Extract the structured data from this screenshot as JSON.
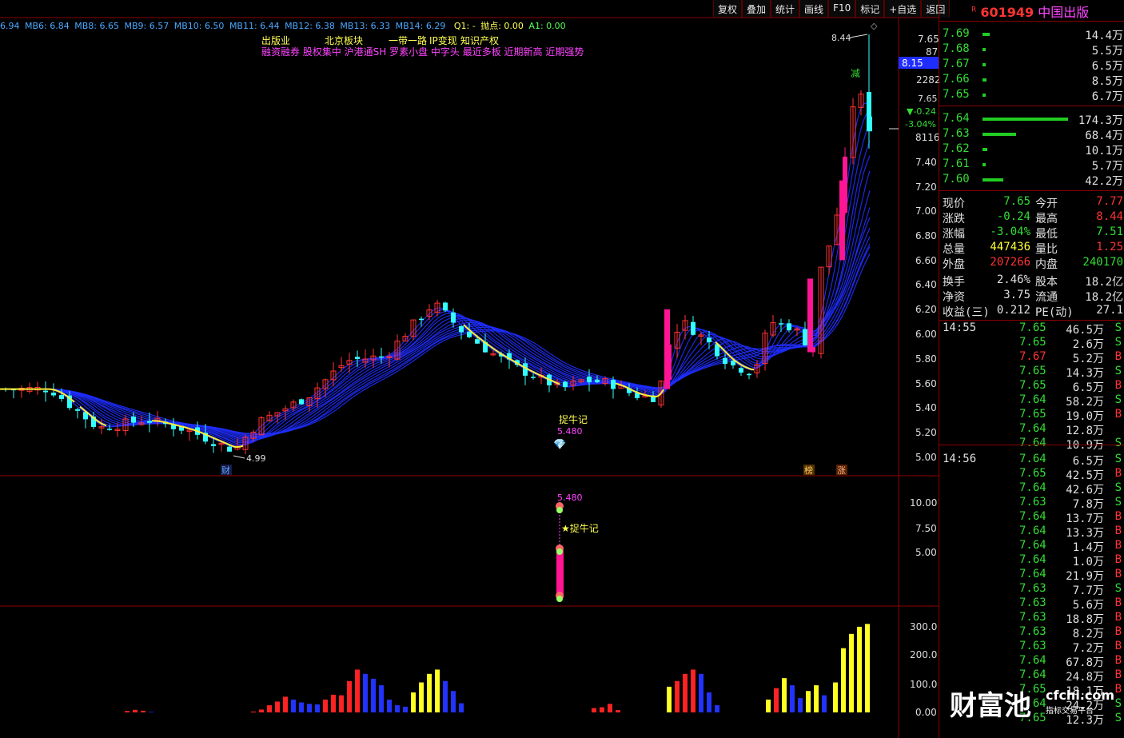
{
  "toolbar": {
    "items": [
      "复权",
      "叠加",
      "统计",
      "画线",
      "F10",
      "标记",
      "+自选",
      "返回"
    ]
  },
  "ma_line": {
    "items": [
      "6.94",
      "MB6: 6.84",
      "MB8: 6.65",
      "MB9: 6.57",
      "MB10: 6.50",
      "MB11: 6.44",
      "MB12: 6.38",
      "MB13: 6.33",
      "MB14: 6.29"
    ],
    "q1": "Q1: -",
    "paodian": "抛点: 0.00",
    "a1": "A1: 0.00"
  },
  "concepts": {
    "row1": [
      "出版业",
      "北京板块",
      "一带一路",
      "IP变现",
      "知识产权"
    ],
    "row2": "融资融券 股权集中 沪港通SH 罗素小盘 中字头 最近多板 近期新高 近期强势"
  },
  "chart_annotations": {
    "high_label": "8.44",
    "low_label": "4.99",
    "bull_label": "捉牛记",
    "bull_price": "5.480",
    "cai": "财",
    "bang": "榜",
    "zhang": "涨",
    "jian": "减",
    "sub_price": "5.480",
    "sub_label": "★捉牛记"
  },
  "price_axis": [
    "7.65",
    "87",
    "8.15",
    "2282",
    "7.65",
    "▼-0.24",
    "-3.04%",
    "8116",
    "7.40",
    "7.20",
    "7.00",
    "6.80",
    "6.60",
    "6.40",
    "6.20",
    "6.00",
    "5.80",
    "5.60",
    "5.40",
    "5.20",
    "5.00"
  ],
  "sub_axis": [
    "10.00",
    "7.50",
    "5.00"
  ],
  "vol_axis": [
    "300.0",
    "200.0",
    "100.0",
    "0.00"
  ],
  "stock": {
    "flag": "R",
    "code": "601949",
    "name": "中国出版"
  },
  "asks": [
    [
      "7.69",
      "14.4万"
    ],
    [
      "7.68",
      "5.5万"
    ],
    [
      "7.67",
      "6.5万"
    ],
    [
      "7.66",
      "8.5万"
    ],
    [
      "7.65",
      "6.7万"
    ]
  ],
  "bids": [
    [
      "7.64",
      "174.3万"
    ],
    [
      "7.63",
      "68.4万"
    ],
    [
      "7.62",
      "10.1万"
    ],
    [
      "7.61",
      "5.7万"
    ],
    [
      "7.60",
      "42.2万"
    ]
  ],
  "stats": [
    [
      "现价",
      "7.65",
      "今开",
      "7.77"
    ],
    [
      "涨跌",
      "-0.24",
      "最高",
      "8.44"
    ],
    [
      "涨幅",
      "-3.04%",
      "最低",
      "7.51"
    ],
    [
      "总量",
      "447436",
      "量比",
      "1.25"
    ],
    [
      "外盘",
      "207266",
      "内盘",
      "240170"
    ],
    [
      "换手",
      "2.46%",
      "股本",
      "18.2亿"
    ],
    [
      "净资",
      "3.75",
      "流通",
      "18.2亿"
    ],
    [
      "收益(三)",
      "0.212",
      "PE(动)",
      "27.1"
    ]
  ],
  "ticks": [
    [
      "14:55",
      "7.65",
      "46.5万",
      "S"
    ],
    [
      "",
      "7.65",
      "2.6万",
      "S"
    ],
    [
      "",
      "7.67",
      "5.2万",
      "B"
    ],
    [
      "",
      "7.65",
      "14.3万",
      "S"
    ],
    [
      "",
      "7.65",
      "6.5万",
      "B"
    ],
    [
      "",
      "7.64",
      "58.2万",
      "S"
    ],
    [
      "",
      "7.65",
      "19.0万",
      "B"
    ],
    [
      "",
      "7.64",
      "12.8万",
      ""
    ],
    [
      "",
      "7.64",
      "10.9万",
      "S"
    ],
    [
      "14:56",
      "7.64",
      "6.5万",
      "S"
    ],
    [
      "",
      "7.65",
      "42.5万",
      "B"
    ],
    [
      "",
      "7.64",
      "42.6万",
      "S"
    ],
    [
      "",
      "7.63",
      "7.8万",
      "S"
    ],
    [
      "",
      "7.64",
      "13.7万",
      "B"
    ],
    [
      "",
      "7.64",
      "13.3万",
      "B"
    ],
    [
      "",
      "7.64",
      "1.4万",
      "B"
    ],
    [
      "",
      "7.64",
      "1.0万",
      "B"
    ],
    [
      "",
      "7.64",
      "21.9万",
      "B"
    ],
    [
      "",
      "7.63",
      "7.7万",
      "S"
    ],
    [
      "",
      "7.63",
      "5.6万",
      "B"
    ],
    [
      "",
      "7.63",
      "18.8万",
      "B"
    ],
    [
      "",
      "7.63",
      "8.2万",
      "B"
    ],
    [
      "",
      "7.63",
      "7.2万",
      "B"
    ],
    [
      "",
      "7.64",
      "67.8万",
      "B"
    ],
    [
      "",
      "7.64",
      "24.8万",
      "B"
    ],
    [
      "",
      "7.65",
      "18.1万",
      "B"
    ],
    [
      "",
      "7.64",
      "24.2万",
      "S"
    ],
    [
      "",
      "7.65",
      "12.3万",
      "S"
    ]
  ],
  "watermark": {
    "brand": "财富池",
    "url": "cfchi.com",
    "sub": "指标交易平台"
  },
  "colors": {
    "up": "#ff3333",
    "down": "#33ffff",
    "ribbon": "#1f2dff",
    "ma_yellow": "#ffee33",
    "magenta": "#ff1493",
    "border": "#8b0000"
  }
}
